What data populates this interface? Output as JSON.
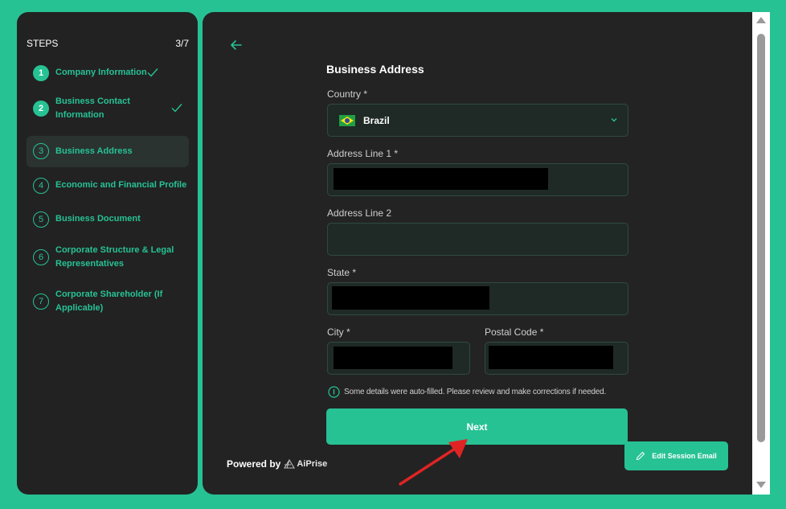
{
  "sidebar": {
    "title": "STEPS",
    "progress": "3/7",
    "steps": [
      {
        "num": "1",
        "label": "Company Information",
        "status": "done"
      },
      {
        "num": "2",
        "label": "Business Contact Information",
        "status": "done"
      },
      {
        "num": "3",
        "label": "Business Address",
        "status": "active"
      },
      {
        "num": "4",
        "label": "Economic and Financial Profile",
        "status": "todo"
      },
      {
        "num": "5",
        "label": "Business Document",
        "status": "todo"
      },
      {
        "num": "6",
        "label": "Corporate Structure & Legal Representatives",
        "status": "todo"
      },
      {
        "num": "7",
        "label": "Corporate Shareholder (If Applicable)",
        "status": "todo"
      }
    ]
  },
  "form": {
    "title": "Business Address",
    "country": {
      "label": "Country *",
      "value": "Brazil",
      "flag": "brazil-flag"
    },
    "address1": {
      "label": "Address Line 1 *",
      "value": ""
    },
    "address2": {
      "label": "Address Line 2",
      "value": ""
    },
    "state": {
      "label": "State *",
      "value": ""
    },
    "city": {
      "label": "City *",
      "value": ""
    },
    "postal": {
      "label": "Postal Code *",
      "value": ""
    },
    "info_note": "Some details were auto-filled. Please review and make corrections if needed.",
    "next_label": "Next"
  },
  "footer": {
    "powered_by": "Powered by",
    "brand_name": "AiPrise",
    "edit_email_label": "Edit Session Email"
  },
  "colors": {
    "accent": "#27c294",
    "panel": "#232323",
    "sidebar": "#222222",
    "input_bg": "#1f2a26",
    "annotation_arrow": "#e02424"
  }
}
